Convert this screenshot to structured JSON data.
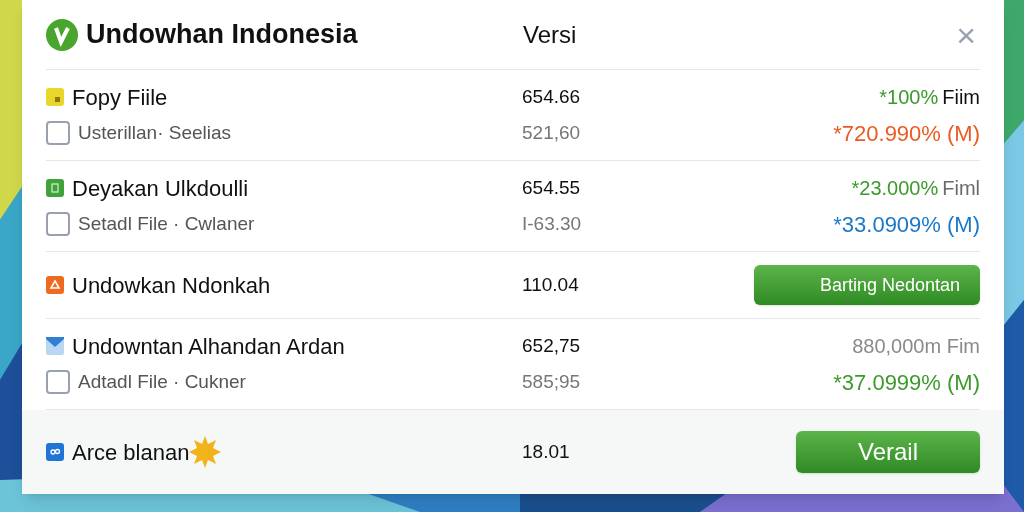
{
  "window": {
    "title": "Undowhan Indonesia",
    "column_header": "Versi",
    "close": "×"
  },
  "groups": [
    {
      "kind": "note",
      "name": "Fopy Fiile",
      "value": "654.66",
      "right": {
        "kind": "status",
        "parts": [
          {
            "text": "*100%",
            "color": "#3c9a2c"
          },
          {
            "text": "Fiim",
            "color": "#111111"
          }
        ]
      },
      "sub": {
        "checked": false,
        "name": "Usterillan· Seelias",
        "value": "521,60",
        "status": {
          "text": "*720.990% (M)",
          "color": "#ec5a22"
        }
      }
    },
    {
      "kind": "sheet",
      "name": "Deyakan Ulkdoulli",
      "value": "654.55",
      "right": {
        "kind": "status",
        "parts": [
          {
            "text": "*23.000%",
            "color": "#3c9a2c"
          },
          {
            "text": "Fiml",
            "color": "#6b6b6b"
          }
        ]
      },
      "sub": {
        "checked": false,
        "name": "Setadl File · Cwlaner",
        "value": "I-63.30",
        "status": {
          "text": "*33.0909% (M)",
          "color": "#1a78c8"
        }
      }
    },
    {
      "kind": "alert",
      "name": "Undowkan Ndonkah",
      "value": "110.04",
      "right": {
        "kind": "button",
        "text": "Barting Nedontan"
      }
    },
    {
      "kind": "mail",
      "name": "Undowntan Alhandan Ardan",
      "value": "652,75",
      "right": {
        "kind": "status",
        "parts": [
          {
            "text": "880,000m Fim",
            "color": "#8a8a8a"
          }
        ]
      },
      "sub": {
        "checked": false,
        "name": "Adtadl File · Cukner",
        "value": "585;95",
        "status": {
          "text": "*37.0999% (M)",
          "color": "#3c9a2c"
        }
      }
    },
    {
      "kind": "link",
      "name": "Arce blanan",
      "sun": true,
      "value": "18.01",
      "footer": true,
      "right": {
        "kind": "button",
        "text": "Verail"
      }
    }
  ]
}
